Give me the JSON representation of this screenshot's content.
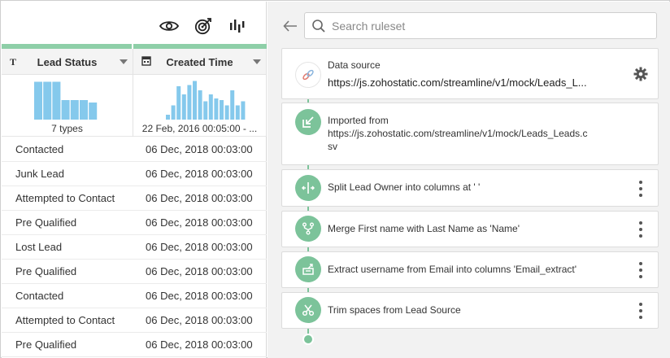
{
  "toolbar": {
    "icons": [
      "eye-icon",
      "target-icon",
      "column-stats-icon"
    ]
  },
  "columns": [
    {
      "type_icon": "T",
      "name": "Lead Status",
      "profile_label": "7 types",
      "bars": [
        0.62,
        0.62,
        0.62,
        0.32,
        0.32,
        0.32,
        0.28
      ]
    },
    {
      "type_icon": "calendar",
      "name": "Created Time",
      "profile_label": "22 Feb, 2016 00:05:00 - ...",
      "bars": [
        0.12,
        0.35,
        0.82,
        0.62,
        0.85,
        0.95,
        0.72,
        0.45,
        0.62,
        0.52,
        0.48,
        0.35,
        0.72,
        0.35,
        0.45
      ]
    }
  ],
  "rows": [
    {
      "status": "Contacted",
      "created": "06 Dec, 2018 00:03:00"
    },
    {
      "status": "Junk Lead",
      "created": "06 Dec, 2018 00:03:00"
    },
    {
      "status": "Attempted to Contact",
      "created": "06 Dec, 2018 00:03:00"
    },
    {
      "status": "Pre Qualified",
      "created": "06 Dec, 2018 00:03:00"
    },
    {
      "status": "Lost Lead",
      "created": "06 Dec, 2018 00:03:00"
    },
    {
      "status": "Pre Qualified",
      "created": "06 Dec, 2018 00:03:00"
    },
    {
      "status": "Contacted",
      "created": "06 Dec, 2018 00:03:00"
    },
    {
      "status": "Attempted to Contact",
      "created": "06 Dec, 2018 00:03:00"
    },
    {
      "status": "Pre Qualified",
      "created": "06 Dec, 2018 00:03:00"
    }
  ],
  "search": {
    "placeholder": "Search ruleset"
  },
  "steps": {
    "source": {
      "title": "Data source",
      "url": "https://js.zohostatic.com/streamline/v1/mock/Leads_L..."
    },
    "imported": {
      "title": "Imported from",
      "line1": "https://js.zohostatic.com/streamline/v1/mock/Leads_Leads.c",
      "line2": "sv"
    },
    "split": {
      "text": "Split Lead Owner into columns at ' '"
    },
    "merge": {
      "text": "Merge First name with Last Name as 'Name'"
    },
    "extract": {
      "text": "Extract username from Email into columns 'Email_extract'"
    },
    "trim": {
      "text": "Trim spaces from Lead Source"
    }
  },
  "colors": {
    "accent": "#7cc39a",
    "histogram": "#85c9ec",
    "header_bar": "#8ecfa8"
  }
}
